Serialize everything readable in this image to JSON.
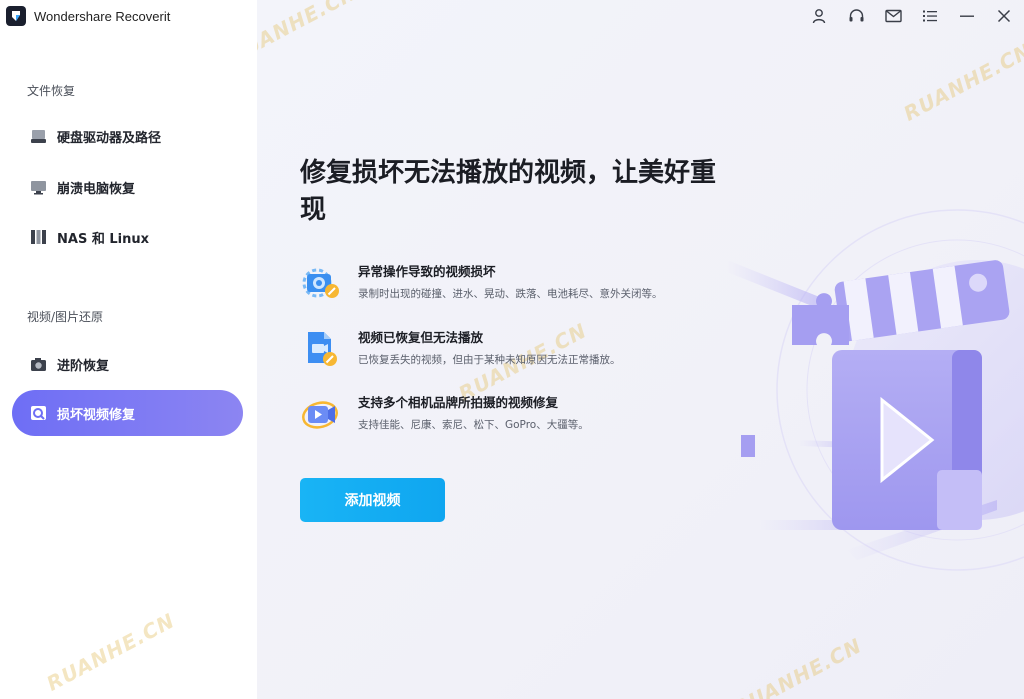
{
  "app": {
    "title": "Wondershare Recoverit"
  },
  "sidebar": {
    "section1": "文件恢复",
    "section2": "视频/图片还原",
    "items": [
      {
        "label": "硬盘驱动器及路径",
        "icon": "hard-drive-icon"
      },
      {
        "label": "崩溃电脑恢复",
        "icon": "monitor-icon"
      },
      {
        "label": "NAS 和 Linux",
        "icon": "nas-icon"
      },
      {
        "label": "进阶恢复",
        "icon": "camera-icon"
      },
      {
        "label": "损坏视频修复",
        "icon": "video-repair-icon",
        "active": true
      }
    ]
  },
  "titlebar": {
    "icons": [
      "user-icon",
      "headset-icon",
      "mail-icon",
      "menu-icon",
      "minimize-icon",
      "close-icon"
    ]
  },
  "main": {
    "headline": "修复损坏无法播放的视频，让美好重现",
    "features": [
      {
        "title": "异常操作导致的视频损坏",
        "desc": "录制时出现的碰撞、进水、晃动、跌落、电池耗尽、意外关闭等。",
        "icon": "camera-gear-icon"
      },
      {
        "title": "视频已恢复但无法播放",
        "desc": "已恢复丢失的视频，但由于某种未知原因无法正常播放。",
        "icon": "video-file-icon"
      },
      {
        "title": "支持多个相机品牌所拍摄的视频修复",
        "desc": "支持佳能、尼康、索尼、松下、GoPro、大疆等。",
        "icon": "video-camera-icon"
      }
    ],
    "add_button": "添加视频"
  },
  "watermark": "RUANHE.CN",
  "colors": {
    "accent": "#7b78f3",
    "button": "#14aef3"
  }
}
